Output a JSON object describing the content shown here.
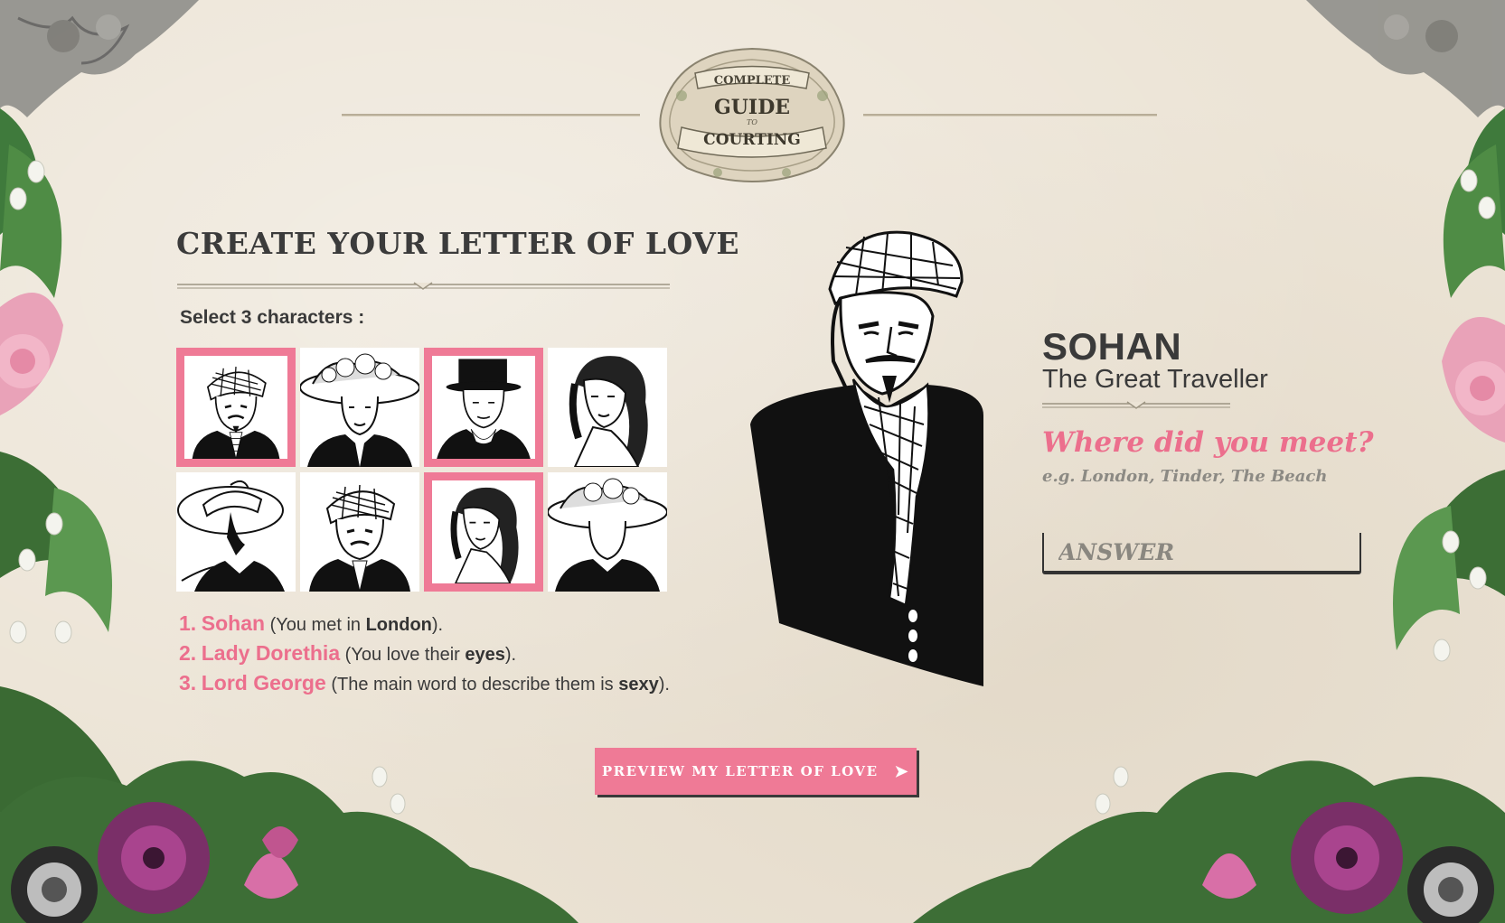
{
  "logo": {
    "line1": "COMPLETE",
    "line2": "GUIDE",
    "line3": "TO",
    "line4": "COURTING"
  },
  "page": {
    "title": "CREATE YOUR LETTER OF LOVE",
    "subtitle": "Select 3 characters :"
  },
  "characters": [
    {
      "tile": "turban-man",
      "selected": true
    },
    {
      "tile": "lady-flower-hat",
      "selected": false
    },
    {
      "tile": "top-hat-gentleman",
      "selected": true
    },
    {
      "tile": "curly-hair-lady",
      "selected": false
    },
    {
      "tile": "wide-hat-lady",
      "selected": false
    },
    {
      "tile": "turban-man",
      "selected": false
    },
    {
      "tile": "curly-hair-lady",
      "selected": true
    },
    {
      "tile": "lady-flower-hat",
      "selected": false
    }
  ],
  "choices": [
    {
      "num": "1.",
      "name": "Sohan",
      "pre": " (You met in ",
      "value": "London",
      "post": ")."
    },
    {
      "num": "2.",
      "name": "Lady Dorethia",
      "pre": " (You love their ",
      "value": "eyes",
      "post": ")."
    },
    {
      "num": "3.",
      "name": "Lord George",
      "pre": " (The main word to describe them is ",
      "value": "sexy",
      "post": ")."
    }
  ],
  "detail": {
    "name": "SOHAN",
    "title": "The Great Traveller",
    "question": "Where did you meet?",
    "hint": "e.g. London, Tinder, The Beach",
    "answer_placeholder": "ANSWER",
    "answer_value": ""
  },
  "cta": {
    "label": "PREVIEW MY LETTER OF LOVE",
    "arrow": "➤"
  },
  "colors": {
    "accent": "#ef7a96",
    "text": "#3a3a3a",
    "paper": "#ece4d6"
  }
}
